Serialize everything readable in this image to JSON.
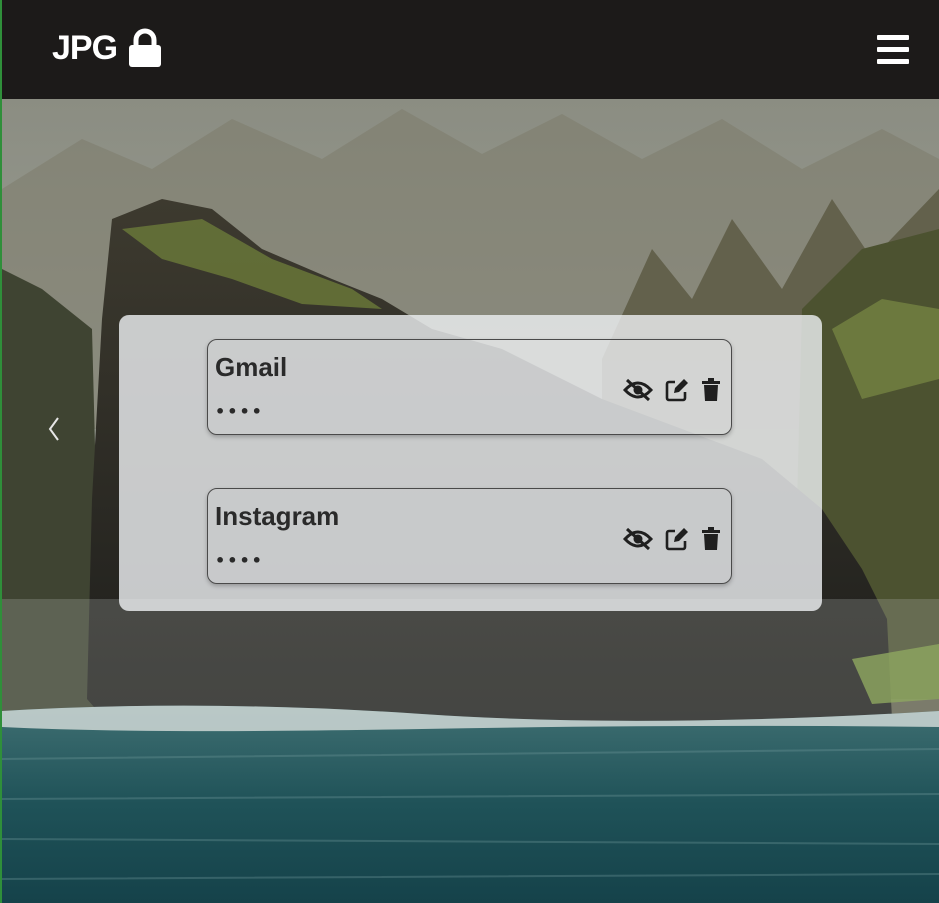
{
  "app": {
    "brand": "JPG",
    "brand_icon": "lock-icon",
    "menu_icon": "hamburger-menu-icon"
  },
  "carousel": {
    "prev_icon": "chevron-left-icon"
  },
  "entries": [
    {
      "title": "Gmail",
      "secret": "••••"
    },
    {
      "title": "Instagram",
      "secret": "••••"
    }
  ],
  "entry_actions": [
    "eye-slash-icon",
    "edit-icon",
    "trash-icon"
  ],
  "colors": {
    "navbar_bg": "#1c1a19",
    "panel_bg": "#eceef0",
    "text_dark": "#2a2a2a"
  }
}
